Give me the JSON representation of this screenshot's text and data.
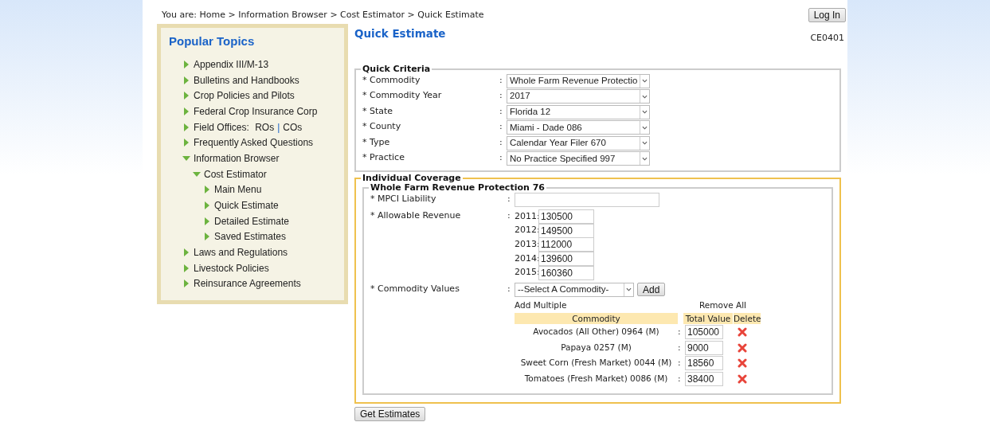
{
  "breadcrumb": {
    "prefix": "You are:",
    "items": [
      "Home",
      "Information Browser",
      "Cost Estimator",
      "Quick Estimate"
    ],
    "separator": ">"
  },
  "login_button": "Log In",
  "sidebar": {
    "title": "Popular Topics",
    "items": [
      {
        "label": "Appendix III/M-13",
        "expanded": false
      },
      {
        "label": "Bulletins and Handbooks",
        "expanded": false
      },
      {
        "label": "Crop Policies and Pilots",
        "expanded": false
      },
      {
        "label": "Federal Crop Insurance Corp",
        "expanded": false
      },
      {
        "label": "Field Offices:",
        "expanded": false,
        "links": [
          "ROs",
          "COs"
        ],
        "separator": "|"
      },
      {
        "label": "Frequently Asked Questions",
        "expanded": false
      },
      {
        "label": "Information Browser",
        "expanded": true,
        "children": [
          {
            "label": "Cost Estimator",
            "expanded": true,
            "children": [
              {
                "label": "Main Menu",
                "expanded": false
              },
              {
                "label": "Quick Estimate",
                "expanded": false
              },
              {
                "label": "Detailed Estimate",
                "expanded": false
              },
              {
                "label": "Saved Estimates",
                "expanded": false
              }
            ]
          }
        ]
      },
      {
        "label": "Laws and Regulations",
        "expanded": false
      },
      {
        "label": "Livestock Policies",
        "expanded": false
      },
      {
        "label": "Reinsurance Agreements",
        "expanded": false
      }
    ]
  },
  "page": {
    "title": "Quick Estimate",
    "code": "CE0401"
  },
  "quick_criteria": {
    "legend": "Quick Criteria",
    "fields": [
      {
        "label": "* Commodity",
        "colon": ":",
        "value": "Whole Farm Revenue Protectio"
      },
      {
        "label": "* Commodity Year",
        "colon": ":",
        "value": "2017"
      },
      {
        "label": "* State",
        "colon": ":",
        "value": "Florida 12"
      },
      {
        "label": "* County",
        "colon": ":",
        "value": "Miami - Dade 086"
      },
      {
        "label": "* Type",
        "colon": ":",
        "value": "Calendar Year Filer 670"
      },
      {
        "label": "* Practice",
        "colon": ":",
        "value": "No Practice Specified 997"
      }
    ]
  },
  "individual_coverage": {
    "legend": "Individual Coverage",
    "plan": {
      "legend": "Whole Farm Revenue Protection 76",
      "mpci_liability": {
        "label": "* MPCI Liability",
        "colon": ":"
      },
      "allowable_revenue": {
        "label": "* Allowable Revenue",
        "colon": ":",
        "years": [
          {
            "year": "2011:",
            "value": "130500"
          },
          {
            "year": "2012:",
            "value": "149500"
          },
          {
            "year": "2013:",
            "value": "112000"
          },
          {
            "year": "2014:",
            "value": "139600"
          },
          {
            "year": "2015:",
            "value": "160360"
          }
        ]
      },
      "commodity_values": {
        "label": "* Commodity Values",
        "colon": ":",
        "select": "--Select A Commodity-",
        "add_button": "Add",
        "add_multiple": "Add Multiple",
        "remove_all": "Remove All",
        "columns": [
          "Commodity",
          "Total Value",
          "Delete"
        ],
        "rows": [
          {
            "commodity": "Avocados (All Other) 0964 (M)",
            "colon": ":",
            "value": "105000"
          },
          {
            "commodity": "Papaya 0257 (M)",
            "colon": ":",
            "value": "9000"
          },
          {
            "commodity": "Sweet Corn (Fresh Market) 0044 (M)",
            "colon": ":",
            "value": "18560"
          },
          {
            "commodity": "Tomatoes (Fresh Market) 0086 (M)",
            "colon": ":",
            "value": "38400"
          }
        ]
      }
    }
  },
  "submit_button": "Get Estimates"
}
